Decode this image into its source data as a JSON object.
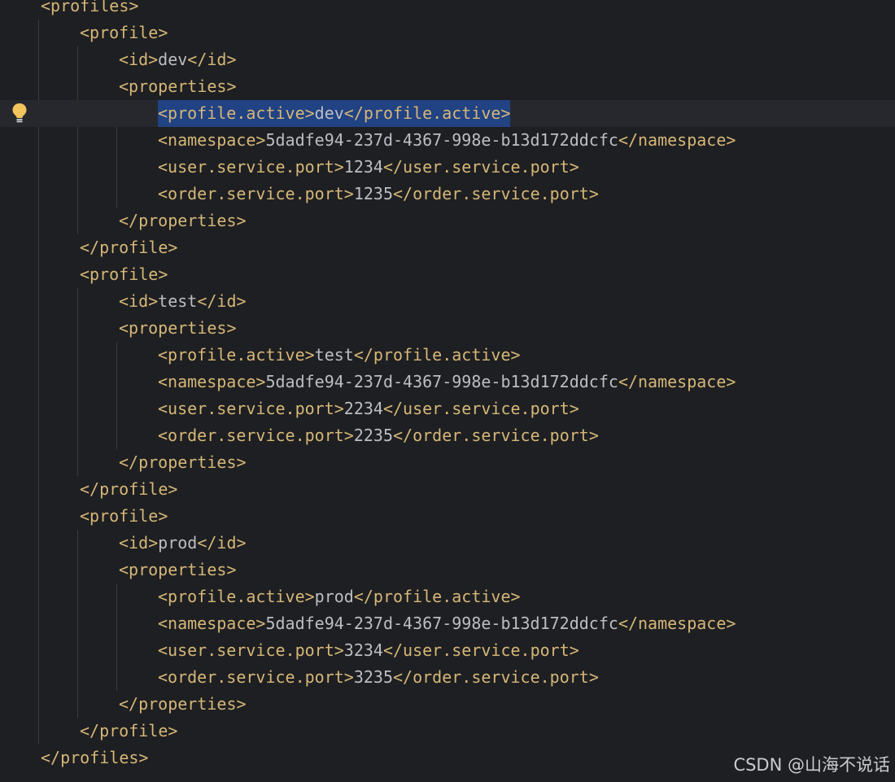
{
  "editor": {
    "lines": [
      {
        "segs": [
          {
            "t": "tag",
            "v": "<profiles>"
          }
        ]
      },
      {
        "segs": [
          {
            "t": "tag",
            "v": "<profile>"
          }
        ]
      },
      {
        "segs": [
          {
            "t": "tag",
            "v": "<id>"
          },
          {
            "t": "txt",
            "v": "dev"
          },
          {
            "t": "tag",
            "v": "</id>"
          }
        ]
      },
      {
        "segs": [
          {
            "t": "tag",
            "v": "<properties>"
          }
        ]
      },
      {
        "segs": [
          {
            "t": "tag",
            "v": "<profile.active>"
          },
          {
            "t": "txt",
            "v": "dev"
          },
          {
            "t": "tag",
            "v": "</profile.active>"
          }
        ]
      },
      {
        "segs": [
          {
            "t": "tag",
            "v": "<namespace>"
          },
          {
            "t": "txt",
            "v": "5dadfe94-237d-4367-998e-b13d172ddcfc"
          },
          {
            "t": "tag",
            "v": "</namespace>"
          }
        ]
      },
      {
        "segs": [
          {
            "t": "tag",
            "v": "<user.service.port>"
          },
          {
            "t": "txt",
            "v": "1234"
          },
          {
            "t": "tag",
            "v": "</user.service.port>"
          }
        ]
      },
      {
        "segs": [
          {
            "t": "tag",
            "v": "<order.service.port>"
          },
          {
            "t": "txt",
            "v": "1235"
          },
          {
            "t": "tag",
            "v": "</order.service.port>"
          }
        ]
      },
      {
        "segs": [
          {
            "t": "tag",
            "v": "</properties>"
          }
        ]
      },
      {
        "segs": [
          {
            "t": "tag",
            "v": "</profile>"
          }
        ]
      },
      {
        "segs": [
          {
            "t": "tag",
            "v": "<profile>"
          }
        ]
      },
      {
        "segs": [
          {
            "t": "tag",
            "v": "<id>"
          },
          {
            "t": "txt",
            "v": "test"
          },
          {
            "t": "tag",
            "v": "</id>"
          }
        ]
      },
      {
        "segs": [
          {
            "t": "tag",
            "v": "<properties>"
          }
        ]
      },
      {
        "segs": [
          {
            "t": "tag",
            "v": "<profile.active>"
          },
          {
            "t": "txt",
            "v": "test"
          },
          {
            "t": "tag",
            "v": "</profile.active>"
          }
        ]
      },
      {
        "segs": [
          {
            "t": "tag",
            "v": "<namespace>"
          },
          {
            "t": "txt",
            "v": "5dadfe94-237d-4367-998e-b13d172ddcfc"
          },
          {
            "t": "tag",
            "v": "</namespace>"
          }
        ]
      },
      {
        "segs": [
          {
            "t": "tag",
            "v": "<user.service.port>"
          },
          {
            "t": "txt",
            "v": "2234"
          },
          {
            "t": "tag",
            "v": "</user.service.port>"
          }
        ]
      },
      {
        "segs": [
          {
            "t": "tag",
            "v": "<order.service.port>"
          },
          {
            "t": "txt",
            "v": "2235"
          },
          {
            "t": "tag",
            "v": "</order.service.port>"
          }
        ]
      },
      {
        "segs": [
          {
            "t": "tag",
            "v": "</properties>"
          }
        ]
      },
      {
        "segs": [
          {
            "t": "tag",
            "v": "</profile>"
          }
        ]
      },
      {
        "segs": [
          {
            "t": "tag",
            "v": "<profile>"
          }
        ]
      },
      {
        "segs": [
          {
            "t": "tag",
            "v": "<id>"
          },
          {
            "t": "txt",
            "v": "prod"
          },
          {
            "t": "tag",
            "v": "</id>"
          }
        ]
      },
      {
        "segs": [
          {
            "t": "tag",
            "v": "<properties>"
          }
        ]
      },
      {
        "segs": [
          {
            "t": "tag",
            "v": "<profile.active>"
          },
          {
            "t": "txt",
            "v": "prod"
          },
          {
            "t": "tag",
            "v": "</profile.active>"
          }
        ]
      },
      {
        "segs": [
          {
            "t": "tag",
            "v": "<namespace>"
          },
          {
            "t": "txt",
            "v": "5dadfe94-237d-4367-998e-b13d172ddcfc"
          },
          {
            "t": "tag",
            "v": "</namespace>"
          }
        ]
      },
      {
        "segs": [
          {
            "t": "tag",
            "v": "<user.service.port>"
          },
          {
            "t": "txt",
            "v": "3234"
          },
          {
            "t": "tag",
            "v": "</user.service.port>"
          }
        ]
      },
      {
        "segs": [
          {
            "t": "tag",
            "v": "<order.service.port>"
          },
          {
            "t": "txt",
            "v": "3235"
          },
          {
            "t": "tag",
            "v": "</order.service.port>"
          }
        ]
      },
      {
        "segs": [
          {
            "t": "tag",
            "v": "</properties>"
          }
        ]
      },
      {
        "segs": [
          {
            "t": "tag",
            "v": "</profile>"
          }
        ]
      },
      {
        "segs": [
          {
            "t": "tag",
            "v": "</profiles>"
          }
        ]
      }
    ],
    "selected_line": 4,
    "gutter_icon": "lightbulb-icon"
  },
  "watermark": "CSDN @山海不说话",
  "colors": {
    "background": "#1e1f22",
    "tag": "#d5b778",
    "text": "#bcbec4",
    "selection": "#214283",
    "current_line": "#26282e",
    "indent_guide": "#393b40",
    "lightbulb": "#f2c55c"
  }
}
